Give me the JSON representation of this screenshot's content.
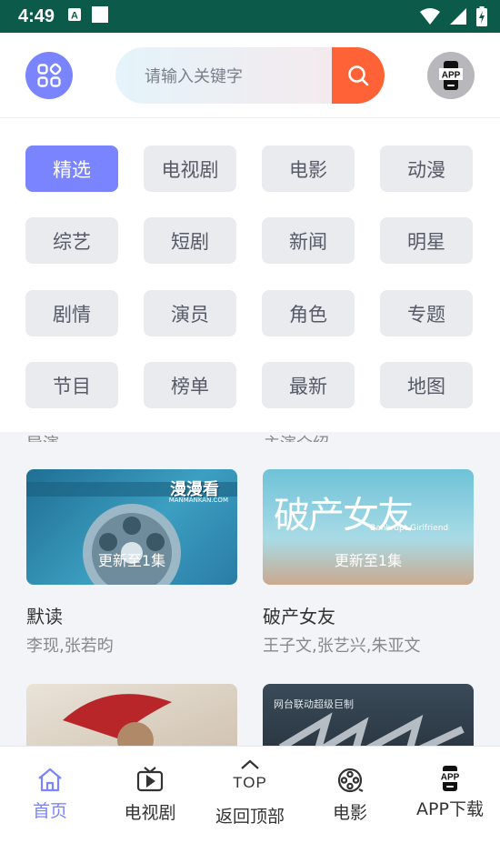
{
  "status": {
    "time": "4:49"
  },
  "header": {
    "menu_icon": "grid-menu-icon",
    "search_placeholder": "请输入关键字",
    "search_icon": "search-icon",
    "app_label": "APP"
  },
  "categories": [
    "精选",
    "电视剧",
    "电影",
    "动漫",
    "综艺",
    "短剧",
    "新闻",
    "明星",
    "剧情",
    "演员",
    "角色",
    "专题",
    "节目",
    "榜单",
    "最新",
    "地图"
  ],
  "active_category": "精选",
  "peek": {
    "left": "导演",
    "right": "主演介绍"
  },
  "cards": [
    {
      "title": "默读",
      "actors": "李现,张若昀",
      "badge": "更新至1集",
      "poster_text": "漫漫看",
      "poster_sub": "MANMANKAN.COM"
    },
    {
      "title": "破产女友",
      "actors": "王子文,张艺兴,朱亚文",
      "badge": "更新至1集",
      "poster_text": "破产女友",
      "poster_sub": "Bankrupt Girlfriend"
    },
    {
      "title": "",
      "actors": "",
      "badge": "",
      "poster_text": "",
      "poster_sub": ""
    },
    {
      "title": "",
      "actors": "",
      "badge": "",
      "poster_text": "网台联动超级巨制",
      "poster_sub": ""
    }
  ],
  "tabs": [
    {
      "label": "首页",
      "icon": "home-icon",
      "active": true
    },
    {
      "label": "电视剧",
      "icon": "tv-icon",
      "active": false
    },
    {
      "label": "返回顶部",
      "top_text": "TOP",
      "icon": "back-to-top-icon",
      "active": false
    },
    {
      "label": "电影",
      "icon": "film-reel-icon",
      "active": false
    },
    {
      "label": "APP下载",
      "icon_text": "APP",
      "icon": "app-download-icon",
      "active": false
    }
  ],
  "colors": {
    "accent": "#7b84ff",
    "search_button": "#ff6236",
    "statusbar": "#0c5a4a"
  }
}
